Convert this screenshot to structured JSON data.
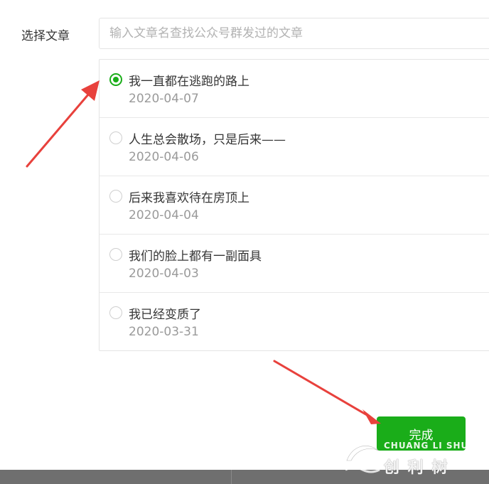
{
  "form": {
    "label": "选择文章",
    "search_placeholder": "输入文章名查找公众号群发过的文章"
  },
  "articles": [
    {
      "title": "我一直都在逃跑的路上",
      "date": "2020-04-07",
      "selected": true
    },
    {
      "title": "人生总会散场，只是后来——",
      "date": "2020-04-06",
      "selected": false
    },
    {
      "title": "后来我喜欢待在房顶上",
      "date": "2020-04-04",
      "selected": false
    },
    {
      "title": "我们的脸上都有一副面具",
      "date": "2020-04-03",
      "selected": false
    },
    {
      "title": "我已经变质了",
      "date": "2020-03-31",
      "selected": false
    }
  ],
  "actions": {
    "done_label": "完成"
  },
  "watermark": {
    "line1": "CHUANG LI SHU",
    "line2": "创 利 树"
  },
  "colors": {
    "accent": "#1aad19",
    "arrow": "#e8413c"
  }
}
